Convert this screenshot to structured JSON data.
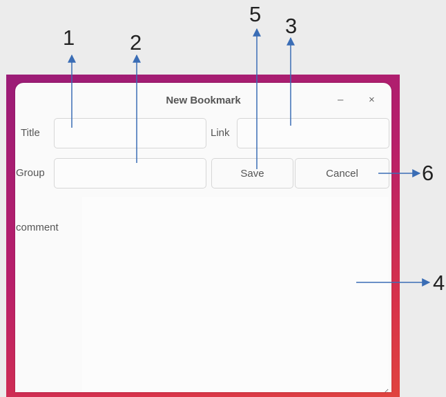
{
  "window": {
    "title": "New Bookmark",
    "minimize_label": "–",
    "close_label": "×"
  },
  "form": {
    "title_label": "Title",
    "title_value": "",
    "link_label": "Link",
    "link_value": "",
    "group_label": "Group",
    "group_value": "",
    "comment_label": "comment",
    "comment_value": "",
    "save_label": "Save",
    "cancel_label": "Cancel"
  },
  "annotations": [
    "1",
    "2",
    "3",
    "4",
    "5",
    "6"
  ],
  "colors": {
    "arrow": "#3a6db5",
    "desktop_gradient": [
      "#9b1c77",
      "#e0443f"
    ],
    "window_bg": "#fafafa"
  }
}
